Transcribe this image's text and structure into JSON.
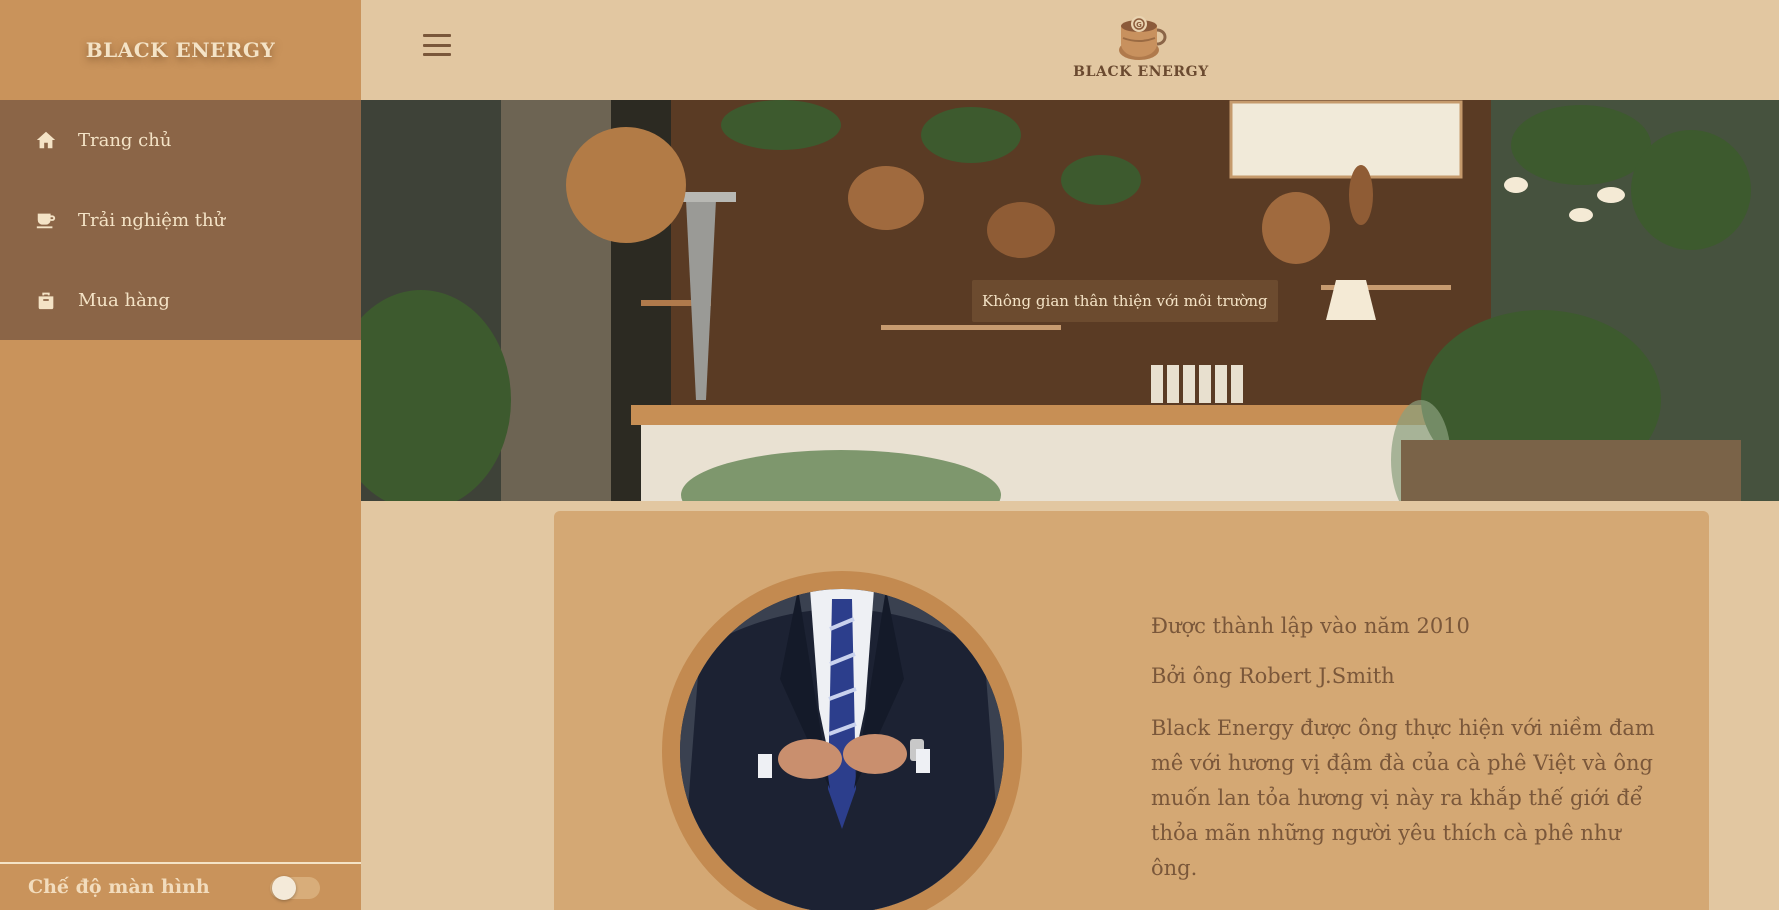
{
  "sidebar": {
    "brand": "BLACK ENERGY",
    "items": [
      {
        "label": "Trang chủ",
        "icon": "home-icon"
      },
      {
        "label": "Trải nghiệm thử",
        "icon": "coffee-cup-icon"
      },
      {
        "label": "Mua hàng",
        "icon": "shopping-bag-icon"
      }
    ],
    "footer": {
      "label": "Chế độ màn hình",
      "toggle_on": false
    }
  },
  "header": {
    "logo_text": "BLACK ENERGY",
    "menu_icon": "hamburger-icon"
  },
  "hero": {
    "caption": "Không gian thân thiện với môi trường"
  },
  "about": {
    "founded": "Được thành lập vào năm 2010",
    "founder": "Bởi ông Robert J.Smith",
    "description": "Black Energy được ông thực hiện với niềm đam mê với hương vị đậm đà của cà phê Việt và ông muốn lan tỏa hương vị này ra khắp thế giới để thỏa mãn những người yêu thích cà phê như ông."
  },
  "colors": {
    "sidebar_bg": "#c9935b",
    "sidebar_menu_bg": "#8b6547",
    "page_bg": "#e2c7a1",
    "card_bg": "#d4a874",
    "text": "#7a573a",
    "light_text": "#f4e3c6"
  }
}
